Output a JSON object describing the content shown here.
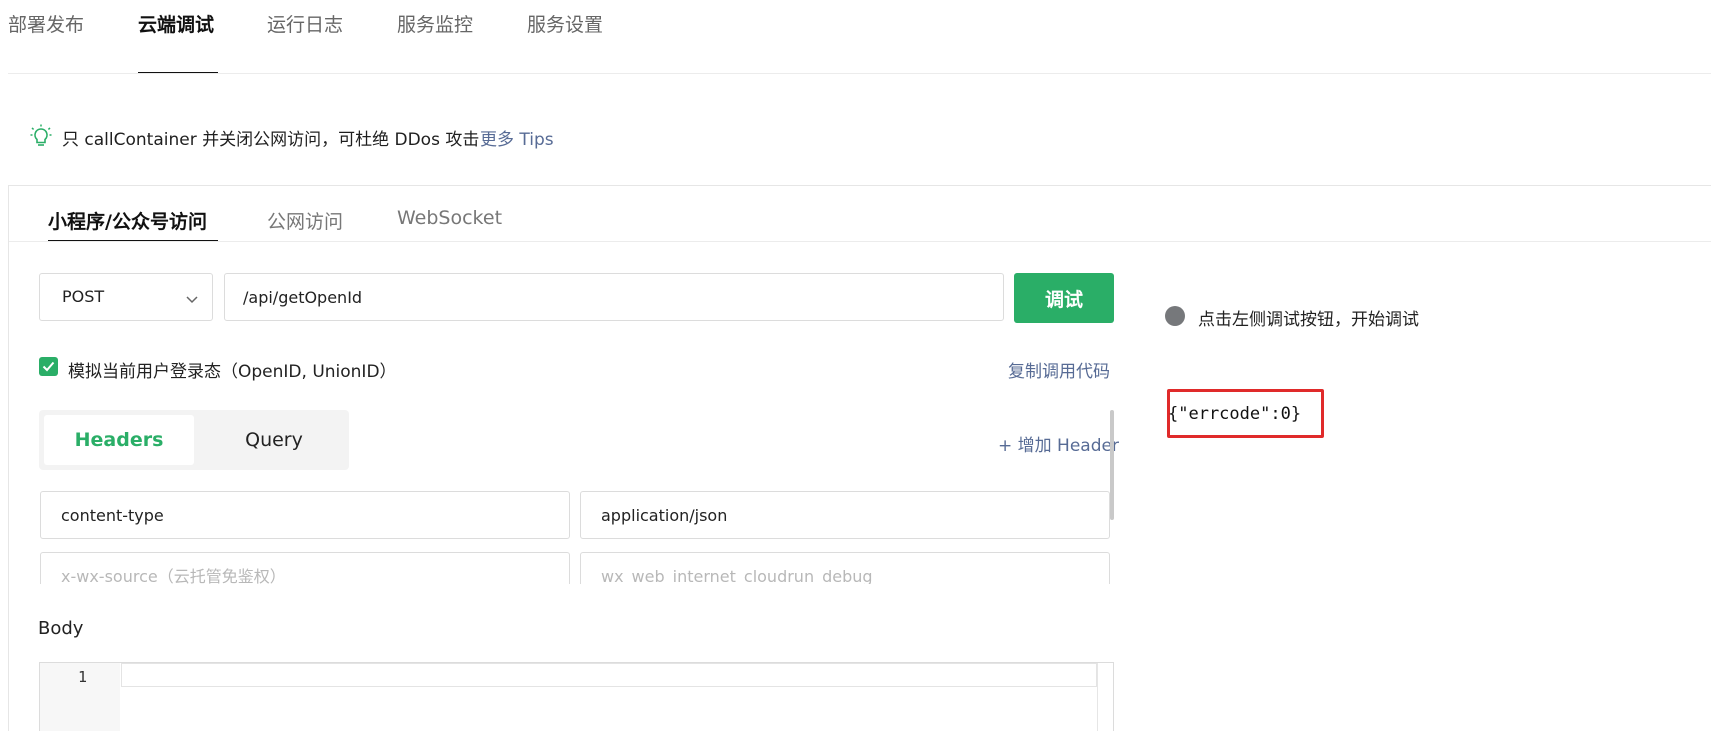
{
  "top_tabs": [
    {
      "label": "部署发布"
    },
    {
      "label": "云端调试"
    },
    {
      "label": "运行日志"
    },
    {
      "label": "服务监控"
    },
    {
      "label": "服务设置"
    }
  ],
  "tip": {
    "icon": "lightbulb-icon",
    "text": "只 callContainer 并关闭公网访问，可杜绝 DDos 攻击",
    "link": "更多 Tips"
  },
  "sub_tabs": [
    {
      "label": "小程序/公众号访问"
    },
    {
      "label": "公网访问"
    },
    {
      "label": "WebSocket"
    }
  ],
  "request": {
    "method": "POST",
    "path": "/api/getOpenId",
    "debug_label": "调试"
  },
  "simulate": {
    "checked": true,
    "label": "模拟当前用户登录态（OpenID, UnionID）",
    "copy_code": "复制调用代码"
  },
  "param_tabs": {
    "headers": "Headers",
    "query": "Query",
    "add_header": "+ 增加 Header"
  },
  "headers": [
    {
      "key": "content-type",
      "value": "application/json"
    },
    {
      "key_placeholder": "x-wx-source（云托管免鉴权）",
      "value_placeholder": "wx_web_internet_cloudrun_debug"
    }
  ],
  "body": {
    "label": "Body",
    "line_number": "1"
  },
  "result": {
    "status_text": "点击左侧调试按钮，开始调试",
    "response": "{\"errcode\":0}"
  },
  "colors": {
    "accent": "#2aae67",
    "link": "#576b95",
    "highlight_box": "#e02a2a"
  }
}
